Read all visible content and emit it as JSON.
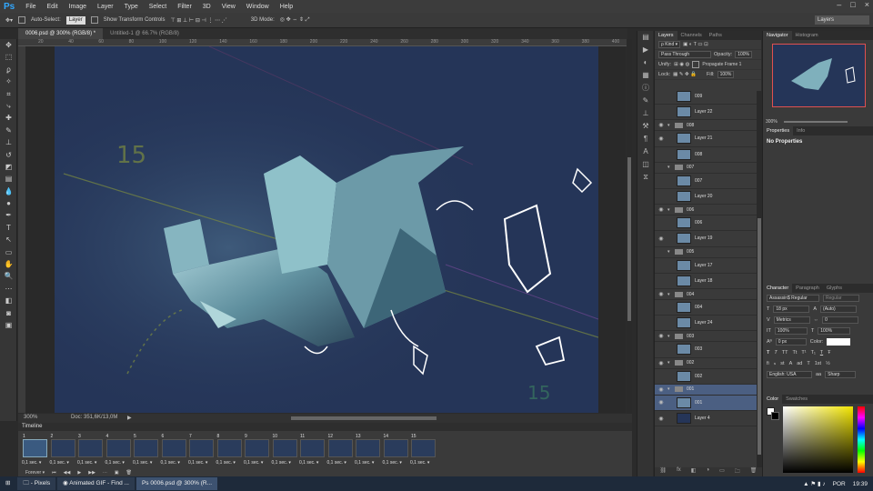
{
  "app": {
    "logo": "Ps"
  },
  "menu": [
    "File",
    "Edit",
    "Image",
    "Layer",
    "Type",
    "Select",
    "Filter",
    "3D",
    "View",
    "Window",
    "Help"
  ],
  "window_controls": [
    "–",
    "□",
    "×"
  ],
  "options": {
    "auto_select": "Auto-Select:",
    "auto_select_value": "Layer",
    "transform_controls": "Show Transform Controls",
    "mode_3d": "3D Mode:"
  },
  "workspace": "Layers",
  "doc_tabs": [
    "0006.psd @ 300% (RGB/8) *",
    "Untitled-1 @ 66.7% (RGB/8)"
  ],
  "ruler_top": [
    "20",
    "40",
    "60",
    "80",
    "100",
    "120",
    "140",
    "160",
    "180",
    "200",
    "220",
    "240",
    "260",
    "280",
    "300",
    "320",
    "340",
    "360",
    "380",
    "400"
  ],
  "status": {
    "zoom": "300%",
    "doc": "Doc: 351,6K/13,0M"
  },
  "canvas_marks": {
    "num_top": "15",
    "num_bottom": "15"
  },
  "timeline": {
    "title": "Timeline",
    "frames": [
      {
        "num": "1",
        "delay": "0,1 sec."
      },
      {
        "num": "2",
        "delay": "0,1 sec."
      },
      {
        "num": "3",
        "delay": "0,1 sec."
      },
      {
        "num": "4",
        "delay": "0,1 sec."
      },
      {
        "num": "5",
        "delay": "0,1 sec."
      },
      {
        "num": "6",
        "delay": "0,1 sec."
      },
      {
        "num": "7",
        "delay": "0,1 sec."
      },
      {
        "num": "8",
        "delay": "0,1 sec."
      },
      {
        "num": "9",
        "delay": "0,1 sec."
      },
      {
        "num": "10",
        "delay": "0,1 sec."
      },
      {
        "num": "11",
        "delay": "0,1 sec."
      },
      {
        "num": "12",
        "delay": "0,1 sec."
      },
      {
        "num": "13",
        "delay": "0,1 sec."
      },
      {
        "num": "14",
        "delay": "0,1 sec."
      },
      {
        "num": "15",
        "delay": "0,1 sec."
      }
    ],
    "loop": "Forever",
    "controls": [
      "⏮",
      "◀◀",
      "▶",
      "▶▶"
    ]
  },
  "layers_panel": {
    "tabs": [
      "Layers",
      "Channels",
      "Paths"
    ],
    "kind": "Kind",
    "blend": "Pass Through",
    "opacity_label": "Opacity:",
    "opacity": "100%",
    "unify": "Unify:",
    "propagate": "Propagate Frame 1",
    "lock": "Lock:",
    "fill_label": "Fill:",
    "fill": "100%",
    "items": [
      {
        "name": "009",
        "type": "layer",
        "eye": ""
      },
      {
        "name": "Layer 22",
        "type": "layer",
        "eye": ""
      },
      {
        "name": "008",
        "type": "group",
        "eye": "👁"
      },
      {
        "name": "Layer 21",
        "type": "layer",
        "eye": "👁"
      },
      {
        "name": "008",
        "type": "layer",
        "eye": ""
      },
      {
        "name": "007",
        "type": "group",
        "eye": ""
      },
      {
        "name": "007",
        "type": "layer",
        "eye": ""
      },
      {
        "name": "Layer 20",
        "type": "layer",
        "eye": ""
      },
      {
        "name": "006",
        "type": "group",
        "eye": "👁"
      },
      {
        "name": "006",
        "type": "layer",
        "eye": ""
      },
      {
        "name": "Layer 19",
        "type": "layer",
        "eye": "👁"
      },
      {
        "name": "005",
        "type": "group",
        "eye": ""
      },
      {
        "name": "Layer 17",
        "type": "layer",
        "eye": ""
      },
      {
        "name": "Layer 18",
        "type": "layer",
        "eye": ""
      },
      {
        "name": "004",
        "type": "group",
        "eye": "👁"
      },
      {
        "name": "004",
        "type": "layer",
        "eye": ""
      },
      {
        "name": "Layer 24",
        "type": "layer",
        "eye": ""
      },
      {
        "name": "003",
        "type": "group",
        "eye": "👁"
      },
      {
        "name": "003",
        "type": "layer",
        "eye": ""
      },
      {
        "name": "002",
        "type": "group",
        "eye": "👁"
      },
      {
        "name": "002",
        "type": "layer",
        "eye": ""
      },
      {
        "name": "001",
        "type": "group",
        "eye": "👁",
        "sel": true
      },
      {
        "name": "001",
        "type": "layer",
        "eye": "👁",
        "sel": true
      },
      {
        "name": "Layer 4",
        "type": "layer",
        "eye": "👁"
      }
    ],
    "footer": [
      "⛓",
      "fx",
      "◧",
      "◑",
      "▭",
      "🗀",
      "🗑"
    ]
  },
  "navigator": {
    "tabs": [
      "Navigator",
      "Histogram"
    ],
    "zoom": "300%"
  },
  "properties": {
    "tabs": [
      "Properties",
      "Info"
    ],
    "empty": "No Properties"
  },
  "character": {
    "tabs": [
      "Character",
      "Paragraph",
      "Glyphs"
    ],
    "font": "Assassin$ Regular",
    "style": "Regular",
    "size": "18 px",
    "leading": "(Auto)",
    "kerning": "Metrics",
    "tracking": "0",
    "vscale": "100%",
    "hscale": "100%",
    "baseline": "0 px",
    "color_label": "Color:",
    "lang": "English: USA",
    "aa": "Sharp",
    "styles": [
      "T",
      "T",
      "TT",
      "Tt",
      "T¹",
      "T₁",
      "T",
      "Ŧ"
    ],
    "opentype": [
      "fi",
      "ℴ",
      "st",
      "A",
      "ad",
      "T",
      "1st",
      "½"
    ]
  },
  "swatches": {
    "tabs": [
      "Color",
      "Swatches"
    ]
  },
  "taskbar": {
    "items": [
      "- Pixels",
      "Animated GIF - Find ...",
      "0006.psd @ 300% (R..."
    ],
    "lang": "POR",
    "time": "19:39"
  },
  "colors": {
    "canvas_bg": "#253558",
    "ui_dark": "#3a3a3a",
    "selected_layer": "#4b5f82",
    "nav_frame": "#e05050"
  }
}
